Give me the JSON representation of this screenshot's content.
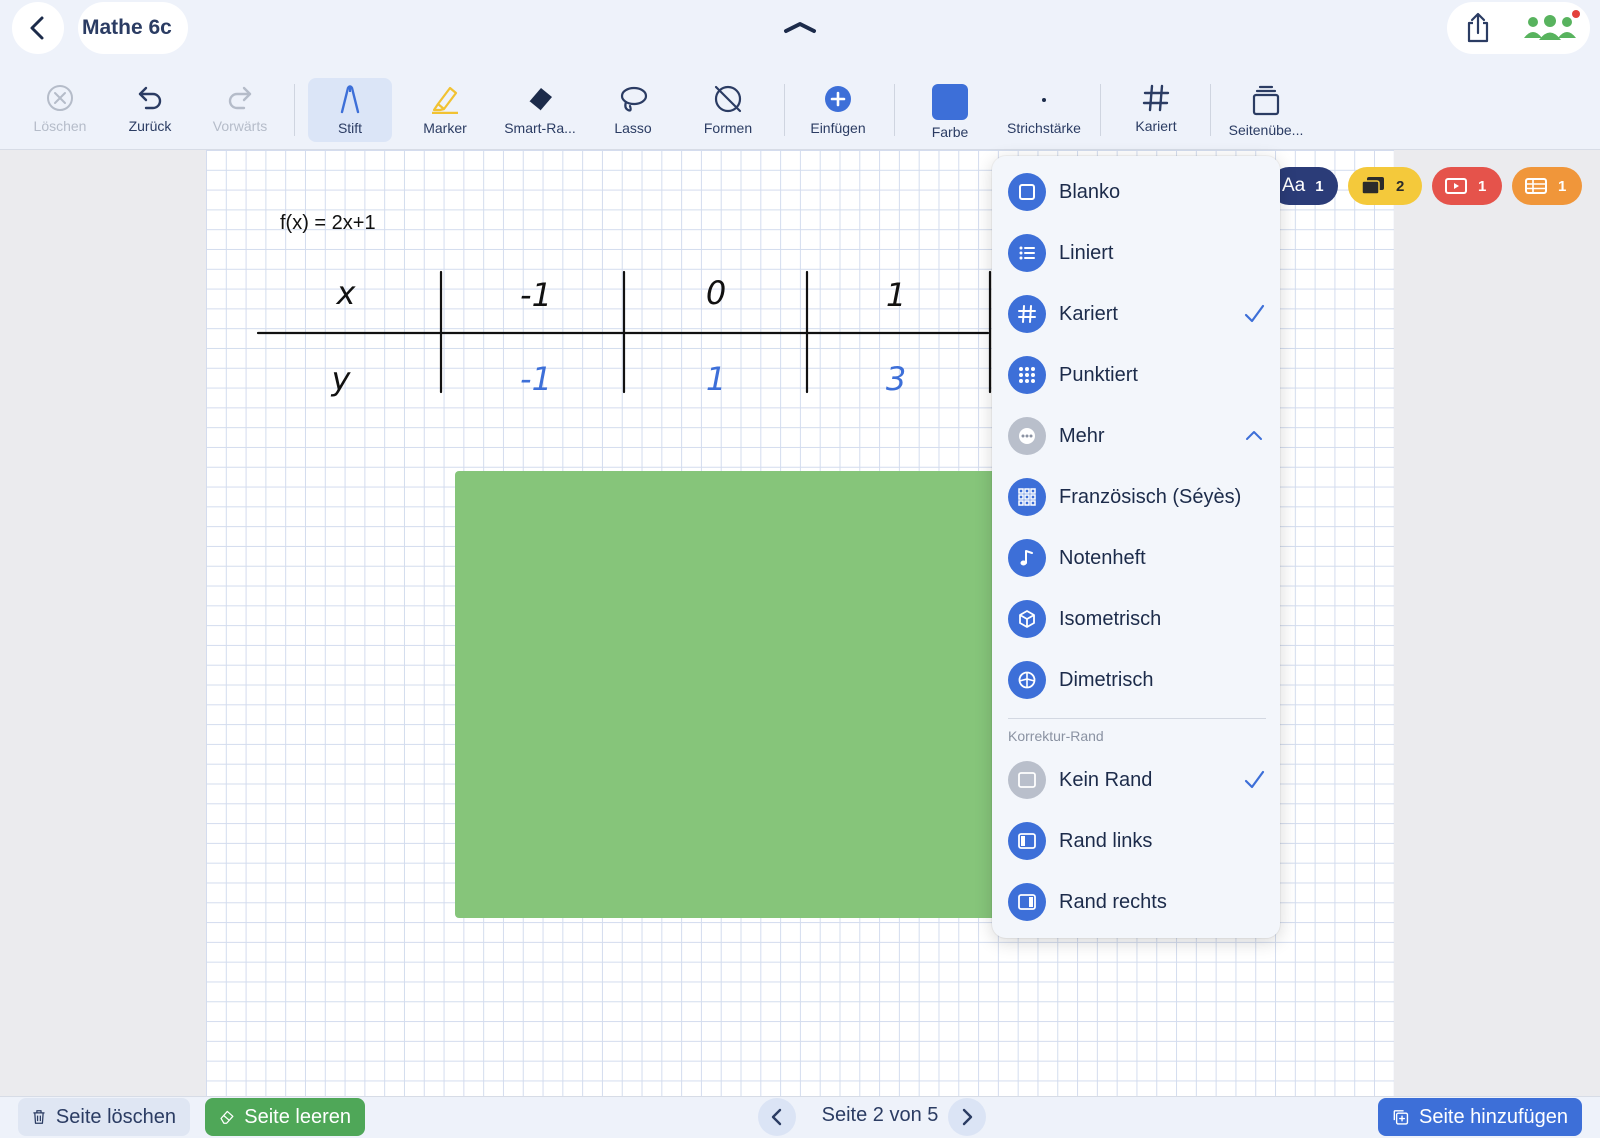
{
  "header": {
    "title": "Mathe 6c"
  },
  "toolbar": {
    "tools": {
      "delete": "Löschen",
      "undo": "Zurück",
      "redo": "Vorwärts",
      "pen": "Stift",
      "marker": "Marker",
      "smart_eraser": "Smart-Ra...",
      "lasso": "Lasso",
      "shapes": "Formen",
      "insert": "Einfügen",
      "color": "Farbe",
      "stroke_width": "Strichstärke",
      "paper": "Kariert",
      "page_overview": "Seitenübe..."
    },
    "active_tool": "Stift",
    "current_color": "#3d6fd8"
  },
  "canvas": {
    "formula": "f(x) = 2x+1",
    "value_table": {
      "row_labels": [
        "x",
        "y"
      ],
      "x_values": [
        "-1",
        "0",
        "1"
      ],
      "y_values": [
        "-1",
        "1",
        "3"
      ]
    },
    "shape_color": "#86c57a"
  },
  "badges": {
    "text": {
      "label": "Aa",
      "count": "1"
    },
    "comments": {
      "count": "2"
    },
    "video": {
      "count": "1"
    },
    "table": {
      "count": "1"
    }
  },
  "paper_menu": {
    "items": [
      {
        "label": "Blanko",
        "icon": "square-icon"
      },
      {
        "label": "Liniert",
        "icon": "list-icon"
      },
      {
        "label": "Kariert",
        "icon": "grid-hash-icon",
        "checked": true
      },
      {
        "label": "Punktiert",
        "icon": "dots-icon"
      },
      {
        "label": "Mehr",
        "icon": "more-icon",
        "expanded": true
      },
      {
        "label": "Französisch (Séyès)",
        "icon": "seyes-grid-icon"
      },
      {
        "label": "Notenheft",
        "icon": "music-note-icon"
      },
      {
        "label": "Isometrisch",
        "icon": "cube-icon"
      },
      {
        "label": "Dimetrisch",
        "icon": "dimetric-icon"
      }
    ],
    "margin_section_title": "Korrektur-Rand",
    "margin_items": [
      {
        "label": "Kein Rand",
        "icon": "no-margin-icon",
        "checked": true
      },
      {
        "label": "Rand links",
        "icon": "margin-left-icon"
      },
      {
        "label": "Rand rechts",
        "icon": "margin-right-icon"
      }
    ]
  },
  "footer": {
    "delete_page": "Seite löschen",
    "clear_page": "Seite leeren",
    "page_indicator": "Seite 2 von 5",
    "add_page": "Seite hinzufügen"
  }
}
